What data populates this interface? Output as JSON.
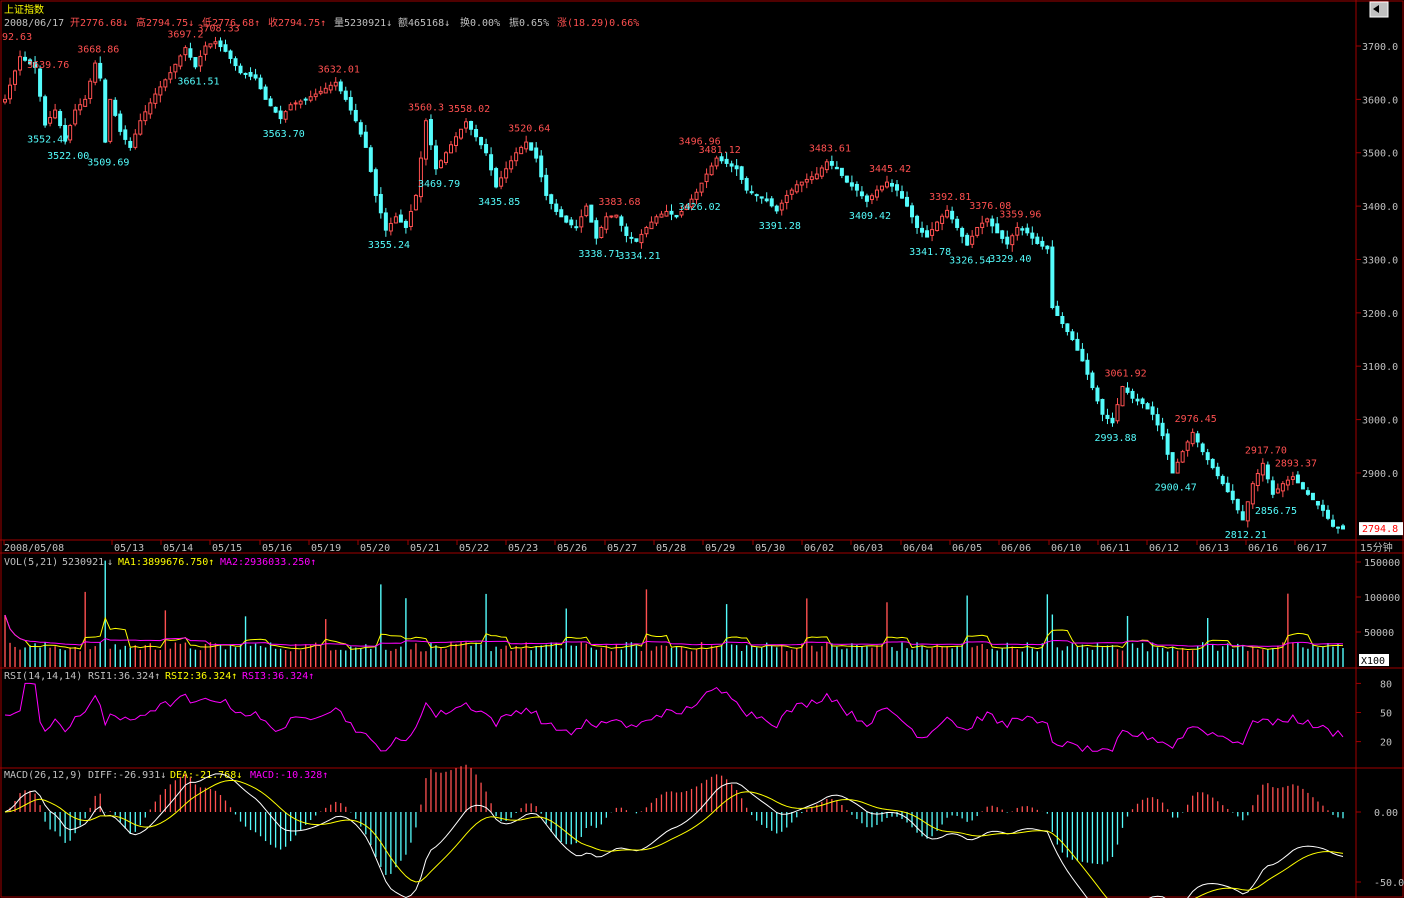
{
  "title": "上证指数",
  "colors": {
    "up": "#ff5050",
    "down": "#54fcfc",
    "frame": "#a00000",
    "axis_text": "#c0c0c0",
    "ma1": "#ffff00",
    "ma2": "#ff00ff",
    "white": "#ffffff",
    "header": "#c0c0c0"
  },
  "header": {
    "date": "2008/06/17",
    "open": "开2776.68↓",
    "high": "高2794.75↓",
    "low": "低2776.68↑",
    "close": "收2794.75↑",
    "volume": "量5230921↓",
    "amount": "额465168↓",
    "turnover": "换0.00%",
    "amplitude": "振0.65%",
    "change": "涨(18.29)0.66%"
  },
  "panels": {
    "price": {
      "y_ticks": [
        "3700.0",
        "3600.0",
        "3500.0",
        "3400.0",
        "3300.0",
        "3200.0",
        "3100.0",
        "3000.0",
        "2900.0"
      ],
      "last_price_tag": "2794.8",
      "period": "15分钟"
    },
    "volume": {
      "header": {
        "label": "VOL(5,21)",
        "value": "5230921",
        "arrow": "↓",
        "ma1": "MA1:3899676.750↑",
        "ma2": "MA2:2936033.250↑"
      },
      "y_ticks": [
        "150000",
        "100000",
        "50000"
      ],
      "unit": "X100"
    },
    "rsi": {
      "header": {
        "label": "RSI(14,14,14)",
        "rsi1": "RSI1:36.324↑",
        "rsi2": "RSI2:36.324↑",
        "rsi3": "RSI3:36.324↑"
      },
      "y_ticks": [
        "80",
        "50",
        "20"
      ]
    },
    "macd": {
      "header": {
        "label": "MACD(26,12,9)",
        "diff": "DIFF:-26.931↓",
        "dea": "DEA:-21.768↓",
        "macd": "MACD:-10.328↑"
      },
      "y_ticks": [
        "0.00",
        "-50.00"
      ]
    }
  },
  "chart_data": {
    "type": "candlestick",
    "interval": "15分钟",
    "x_dates": [
      "2008/05/08",
      "05/13",
      "05/14",
      "05/15",
      "05/16",
      "05/19",
      "05/20",
      "05/21",
      "05/22",
      "05/23",
      "05/26",
      "05/27",
      "05/28",
      "05/29",
      "05/30",
      "06/02",
      "06/03",
      "06/04",
      "06/05",
      "06/06",
      "06/10",
      "06/11",
      "06/12",
      "06/13",
      "06/16",
      "06/17"
    ],
    "ylim": [
      2780,
      3730
    ],
    "price_path": [
      [
        0,
        3600
      ],
      [
        3,
        3680
      ],
      [
        6,
        3660
      ],
      [
        8,
        3552
      ],
      [
        10,
        3580
      ],
      [
        12,
        3522
      ],
      [
        14,
        3580
      ],
      [
        16,
        3600
      ],
      [
        18,
        3668
      ],
      [
        19,
        3640
      ],
      [
        20,
        3520
      ],
      [
        21,
        3600
      ],
      [
        23,
        3540
      ],
      [
        25,
        3510
      ],
      [
        27,
        3560
      ],
      [
        30,
        3610
      ],
      [
        33,
        3650
      ],
      [
        36,
        3697
      ],
      [
        38,
        3661
      ],
      [
        40,
        3700
      ],
      [
        42,
        3708
      ],
      [
        44,
        3690
      ],
      [
        47,
        3650
      ],
      [
        50,
        3640
      ],
      [
        52,
        3600
      ],
      [
        55,
        3564
      ],
      [
        57,
        3590
      ],
      [
        60,
        3600
      ],
      [
        63,
        3615
      ],
      [
        66,
        3632
      ],
      [
        68,
        3600
      ],
      [
        70,
        3560
      ],
      [
        72,
        3510
      ],
      [
        74,
        3420
      ],
      [
        76,
        3355
      ],
      [
        78,
        3380
      ],
      [
        80,
        3360
      ],
      [
        82,
        3420
      ],
      [
        84,
        3560
      ],
      [
        86,
        3470
      ],
      [
        88,
        3500
      ],
      [
        90,
        3530
      ],
      [
        92,
        3558
      ],
      [
        94,
        3530
      ],
      [
        96,
        3500
      ],
      [
        98,
        3436
      ],
      [
        100,
        3470
      ],
      [
        102,
        3500
      ],
      [
        104,
        3520
      ],
      [
        106,
        3490
      ],
      [
        108,
        3420
      ],
      [
        110,
        3390
      ],
      [
        112,
        3370
      ],
      [
        114,
        3360
      ],
      [
        116,
        3400
      ],
      [
        118,
        3340
      ],
      [
        120,
        3380
      ],
      [
        122,
        3383
      ],
      [
        124,
        3345
      ],
      [
        126,
        3334
      ],
      [
        128,
        3360
      ],
      [
        130,
        3380
      ],
      [
        132,
        3390
      ],
      [
        134,
        3380
      ],
      [
        136,
        3400
      ],
      [
        138,
        3426
      ],
      [
        140,
        3460
      ],
      [
        142,
        3490
      ],
      [
        144,
        3480
      ],
      [
        146,
        3470
      ],
      [
        148,
        3430
      ],
      [
        150,
        3420
      ],
      [
        152,
        3410
      ],
      [
        154,
        3391
      ],
      [
        156,
        3420
      ],
      [
        158,
        3440
      ],
      [
        160,
        3450
      ],
      [
        162,
        3460
      ],
      [
        164,
        3483
      ],
      [
        166,
        3470
      ],
      [
        168,
        3445
      ],
      [
        170,
        3430
      ],
      [
        172,
        3409
      ],
      [
        174,
        3430
      ],
      [
        176,
        3445
      ],
      [
        178,
        3430
      ],
      [
        180,
        3400
      ],
      [
        182,
        3360
      ],
      [
        184,
        3342
      ],
      [
        186,
        3370
      ],
      [
        188,
        3392
      ],
      [
        190,
        3360
      ],
      [
        192,
        3327
      ],
      [
        194,
        3360
      ],
      [
        196,
        3376
      ],
      [
        198,
        3350
      ],
      [
        200,
        3329
      ],
      [
        202,
        3360
      ],
      [
        204,
        3350
      ],
      [
        206,
        3330
      ],
      [
        208,
        3320
      ],
      [
        209,
        3210
      ],
      [
        211,
        3180
      ],
      [
        213,
        3150
      ],
      [
        215,
        3110
      ],
      [
        217,
        3060
      ],
      [
        219,
        3010
      ],
      [
        221,
        2994
      ],
      [
        223,
        3062
      ],
      [
        225,
        3040
      ],
      [
        227,
        3030
      ],
      [
        229,
        3010
      ],
      [
        231,
        2970
      ],
      [
        233,
        2900
      ],
      [
        235,
        2940
      ],
      [
        237,
        2976
      ],
      [
        239,
        2940
      ],
      [
        241,
        2910
      ],
      [
        243,
        2880
      ],
      [
        245,
        2850
      ],
      [
        247,
        2812
      ],
      [
        249,
        2880
      ],
      [
        251,
        2918
      ],
      [
        253,
        2860
      ],
      [
        255,
        2880
      ],
      [
        257,
        2893
      ],
      [
        259,
        2870
      ],
      [
        261,
        2850
      ],
      [
        263,
        2830
      ],
      [
        265,
        2800
      ],
      [
        267,
        2795
      ]
    ],
    "annotations": [
      {
        "x": 0,
        "v": "92.63",
        "type": "high"
      },
      {
        "x": 8,
        "v": "3639.76",
        "type": "high"
      },
      {
        "x": 18,
        "v": "3668.86",
        "type": "high"
      },
      {
        "x": 36,
        "v": "3697.2",
        "type": "high"
      },
      {
        "x": 42,
        "v": "3708.33",
        "type": "high"
      },
      {
        "x": 66,
        "v": "3632.01",
        "type": "high"
      },
      {
        "x": 84,
        "v": "3560.3",
        "type": "high"
      },
      {
        "x": 92,
        "v": "3558.02",
        "type": "high"
      },
      {
        "x": 104,
        "v": "3520.64",
        "type": "high"
      },
      {
        "x": 122,
        "v": "3383.68",
        "type": "high"
      },
      {
        "x": 138,
        "v": "3496.96",
        "type": "high"
      },
      {
        "x": 142,
        "v": "3481.12",
        "type": "high"
      },
      {
        "x": 164,
        "v": "3483.61",
        "type": "high"
      },
      {
        "x": 176,
        "v": "3445.42",
        "type": "high"
      },
      {
        "x": 188,
        "v": "3392.81",
        "type": "high"
      },
      {
        "x": 196,
        "v": "3376.08",
        "type": "high"
      },
      {
        "x": 202,
        "v": "3359.96",
        "type": "high"
      },
      {
        "x": 223,
        "v": "3061.92",
        "type": "high"
      },
      {
        "x": 237,
        "v": "2976.45",
        "type": "high"
      },
      {
        "x": 251,
        "v": "2917.70",
        "type": "high"
      },
      {
        "x": 257,
        "v": "2893.37",
        "type": "high"
      },
      {
        "x": 8,
        "v": "3552.47",
        "type": "low"
      },
      {
        "x": 12,
        "v": "3522.00",
        "type": "low"
      },
      {
        "x": 20,
        "v": "3509.69",
        "type": "low"
      },
      {
        "x": 38,
        "v": "3661.51",
        "type": "low"
      },
      {
        "x": 55,
        "v": "3563.70",
        "type": "low"
      },
      {
        "x": 76,
        "v": "3355.24",
        "type": "low"
      },
      {
        "x": 86,
        "v": "3469.79",
        "type": "low"
      },
      {
        "x": 98,
        "v": "3435.85",
        "type": "low"
      },
      {
        "x": 118,
        "v": "3338.71",
        "type": "low"
      },
      {
        "x": 126,
        "v": "3334.21",
        "type": "low"
      },
      {
        "x": 138,
        "v": "3426.02",
        "type": "low"
      },
      {
        "x": 154,
        "v": "3391.28",
        "type": "low"
      },
      {
        "x": 172,
        "v": "3409.42",
        "type": "low"
      },
      {
        "x": 184,
        "v": "3341.78",
        "type": "low"
      },
      {
        "x": 192,
        "v": "3326.54",
        "type": "low"
      },
      {
        "x": 200,
        "v": "3329.40",
        "type": "low"
      },
      {
        "x": 221,
        "v": "2993.88",
        "type": "low"
      },
      {
        "x": 233,
        "v": "2900.47",
        "type": "low"
      },
      {
        "x": 247,
        "v": "2812.21",
        "type": "low"
      },
      {
        "x": 253,
        "v": "2856.75",
        "type": "low"
      }
    ],
    "volume_ylim": [
      0,
      160000
    ],
    "rsi_ylim": [
      0,
      100
    ],
    "macd_ylim": [
      -60,
      30
    ]
  }
}
